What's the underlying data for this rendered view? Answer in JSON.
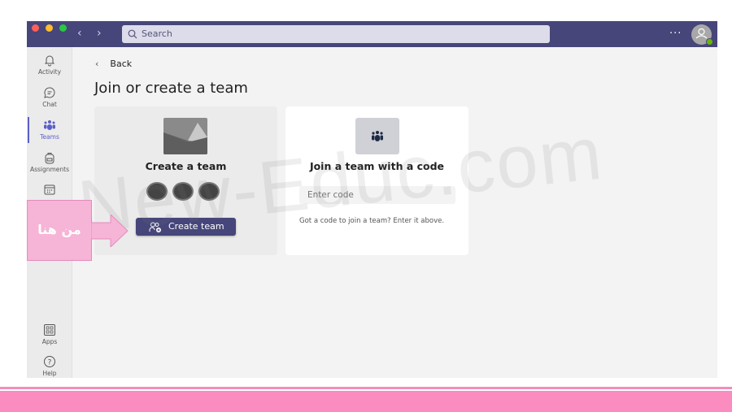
{
  "titlebar": {
    "search_placeholder": "Search",
    "more_label": "...",
    "colors": {
      "bar": "#46467a"
    }
  },
  "sidebar": {
    "items": [
      {
        "label": "Activity",
        "icon": "bell-icon"
      },
      {
        "label": "Chat",
        "icon": "chat-icon"
      },
      {
        "label": "Teams",
        "icon": "teams-icon",
        "active": true
      },
      {
        "label": "Assignments",
        "icon": "backpack-icon"
      },
      {
        "label": "",
        "icon": "calendar-icon"
      },
      {
        "label": "Apps",
        "icon": "apps-icon"
      },
      {
        "label": "Help",
        "icon": "help-icon"
      }
    ]
  },
  "main": {
    "back_label": "Back",
    "title": "Join or create a team",
    "create_card": {
      "heading": "Create a team",
      "button_label": "Create team"
    },
    "join_card": {
      "heading": "Join a team with a code",
      "code_placeholder": "Enter code",
      "hint": "Got a code to join a team? Enter it above."
    }
  },
  "overlay": {
    "callout_text": "من هنا",
    "watermark": "New-Educ.com",
    "colors": {
      "pink": "#fa8cbf",
      "callout": "#f6b4d6"
    }
  }
}
